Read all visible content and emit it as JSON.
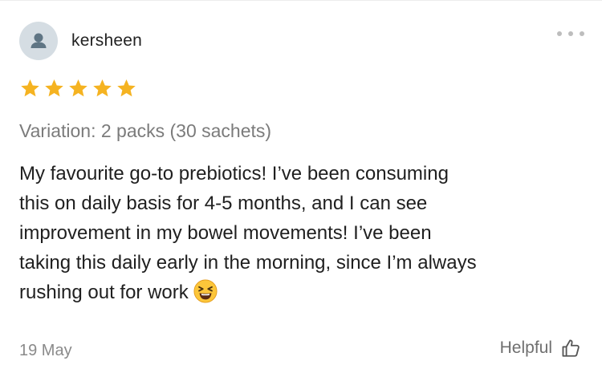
{
  "review": {
    "username": "kersheen",
    "avatar_icon": "user-silhouette-icon",
    "menu_icon": "more-dots-icon",
    "rating": 5,
    "rating_max": 5,
    "star_color": "#F5B321",
    "variation": "Variation: 2 packs (30 sachets)",
    "text_lines": [
      "My favourite go-to prebiotics! I’ve been consuming",
      "this on daily basis for 4-5 months, and I can see",
      "improvement in my bowel movements! I’ve been",
      "taking this daily early in the morning, since I’m always",
      "rushing out for work"
    ],
    "emoji": "laughing-face-emoji",
    "date": "19 May",
    "helpful_label": "Helpful",
    "helpful_icon": "thumbs-up-icon"
  }
}
